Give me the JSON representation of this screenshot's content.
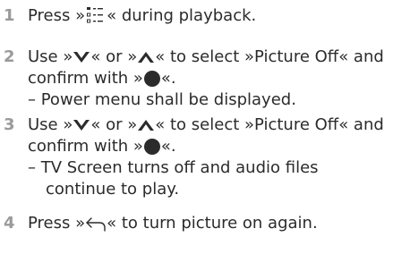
{
  "steps": [
    {
      "number": "1",
      "press_prefix": "Press »",
      "press_suffix": "« during playback.",
      "icon": "menu-list-icon"
    },
    {
      "number": "2",
      "line1_a": "Use »",
      "line1_b": "« or »",
      "line1_c": "« to select »Picture Off« and",
      "line2_a": "confirm with »",
      "line2_b": "«.",
      "sub": "– Power menu shall be displayed.",
      "icons": [
        "chevron-down-icon",
        "chevron-up-icon",
        "ok-circle-icon"
      ]
    },
    {
      "number": "3",
      "line1_a": "Use »",
      "line1_b": "« or »",
      "line1_c": "« to select »Picture Off« and",
      "line2_a": "confirm with »",
      "line2_b": "«.",
      "sub1": "– TV Screen turns off and audio files",
      "sub2": "continue to play.",
      "icons": [
        "chevron-down-icon",
        "chevron-up-icon",
        "ok-circle-icon"
      ]
    },
    {
      "number": "4",
      "line_a": "Press »",
      "line_b": "« to turn picture on again.",
      "icon": "back-arrow-icon"
    }
  ],
  "colors": {
    "text": "#2b2b2b",
    "step_number": "#9a9a9a",
    "icon": "#2b2b2b"
  }
}
